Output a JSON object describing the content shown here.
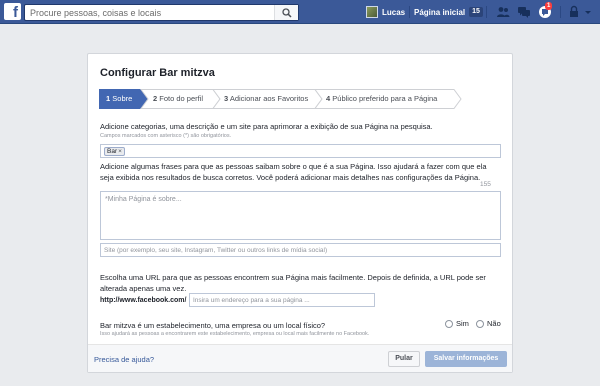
{
  "topbar": {
    "logo": "f",
    "search_placeholder": "Procure pessoas, coisas e locais",
    "user_name": "Lucas",
    "home_label": "Página inicial",
    "home_count": "15",
    "notification_count": "1"
  },
  "dialog": {
    "title": "Configurar Bar mitzva",
    "steps": [
      {
        "num": "1",
        "label": "Sobre"
      },
      {
        "num": "2",
        "label": "Foto do perfil"
      },
      {
        "num": "3",
        "label": "Adicionar aos Favoritos"
      },
      {
        "num": "4",
        "label": "Público preferido para a Página"
      }
    ],
    "intro": "Adicione categorias, uma descrição e um site para aprimorar a exibição de sua Página na pesquisa.",
    "required_note": "Campos marcados com asterisco (*) são obrigatórios.",
    "category_token": "Bar",
    "token_remove": "×",
    "about_instructions_line1": "Adicione algumas frases para que as pessoas saibam sobre o que é a sua Página. Isso ajudará a fazer com que ela",
    "about_instructions_line2": "seja exibida nos resultados de busca corretos. Você poderá adicionar mais detalhes nas configurações da Página.",
    "char_counter": "155",
    "about_placeholder": "*Minha Página é sobre...",
    "site_placeholder": "Site (por exemplo, seu site, Instagram, Twitter ou outros links de mídia social)",
    "url_instructions_line1": "Escolha uma URL para que as pessoas encontrem sua Página mais facilmente. Depois de definida, a URL pode ser",
    "url_instructions_line2": "alterada apenas uma vez.",
    "url_prefix": "http://www.facebook.com/",
    "url_placeholder": "Insira um endereço para a sua página ...",
    "establishment_question": "Bar mitzva é um estabelecimento, uma empresa ou um local físico?",
    "establishment_note": "Isso ajudará as pessoas a encontrarem este estabelecimento, empresa ou local mais facilmente no Facebook.",
    "yes_label": "Sim",
    "no_label": "Não",
    "help_link": "Precisa de ajuda?",
    "skip_button": "Pular",
    "save_button": "Salvar informações"
  },
  "colors": {
    "brand_blue": "#3b5998",
    "active_step": "#4267b2",
    "notification_red": "#fa3e3e",
    "save_disabled": "#9cb4d8"
  }
}
